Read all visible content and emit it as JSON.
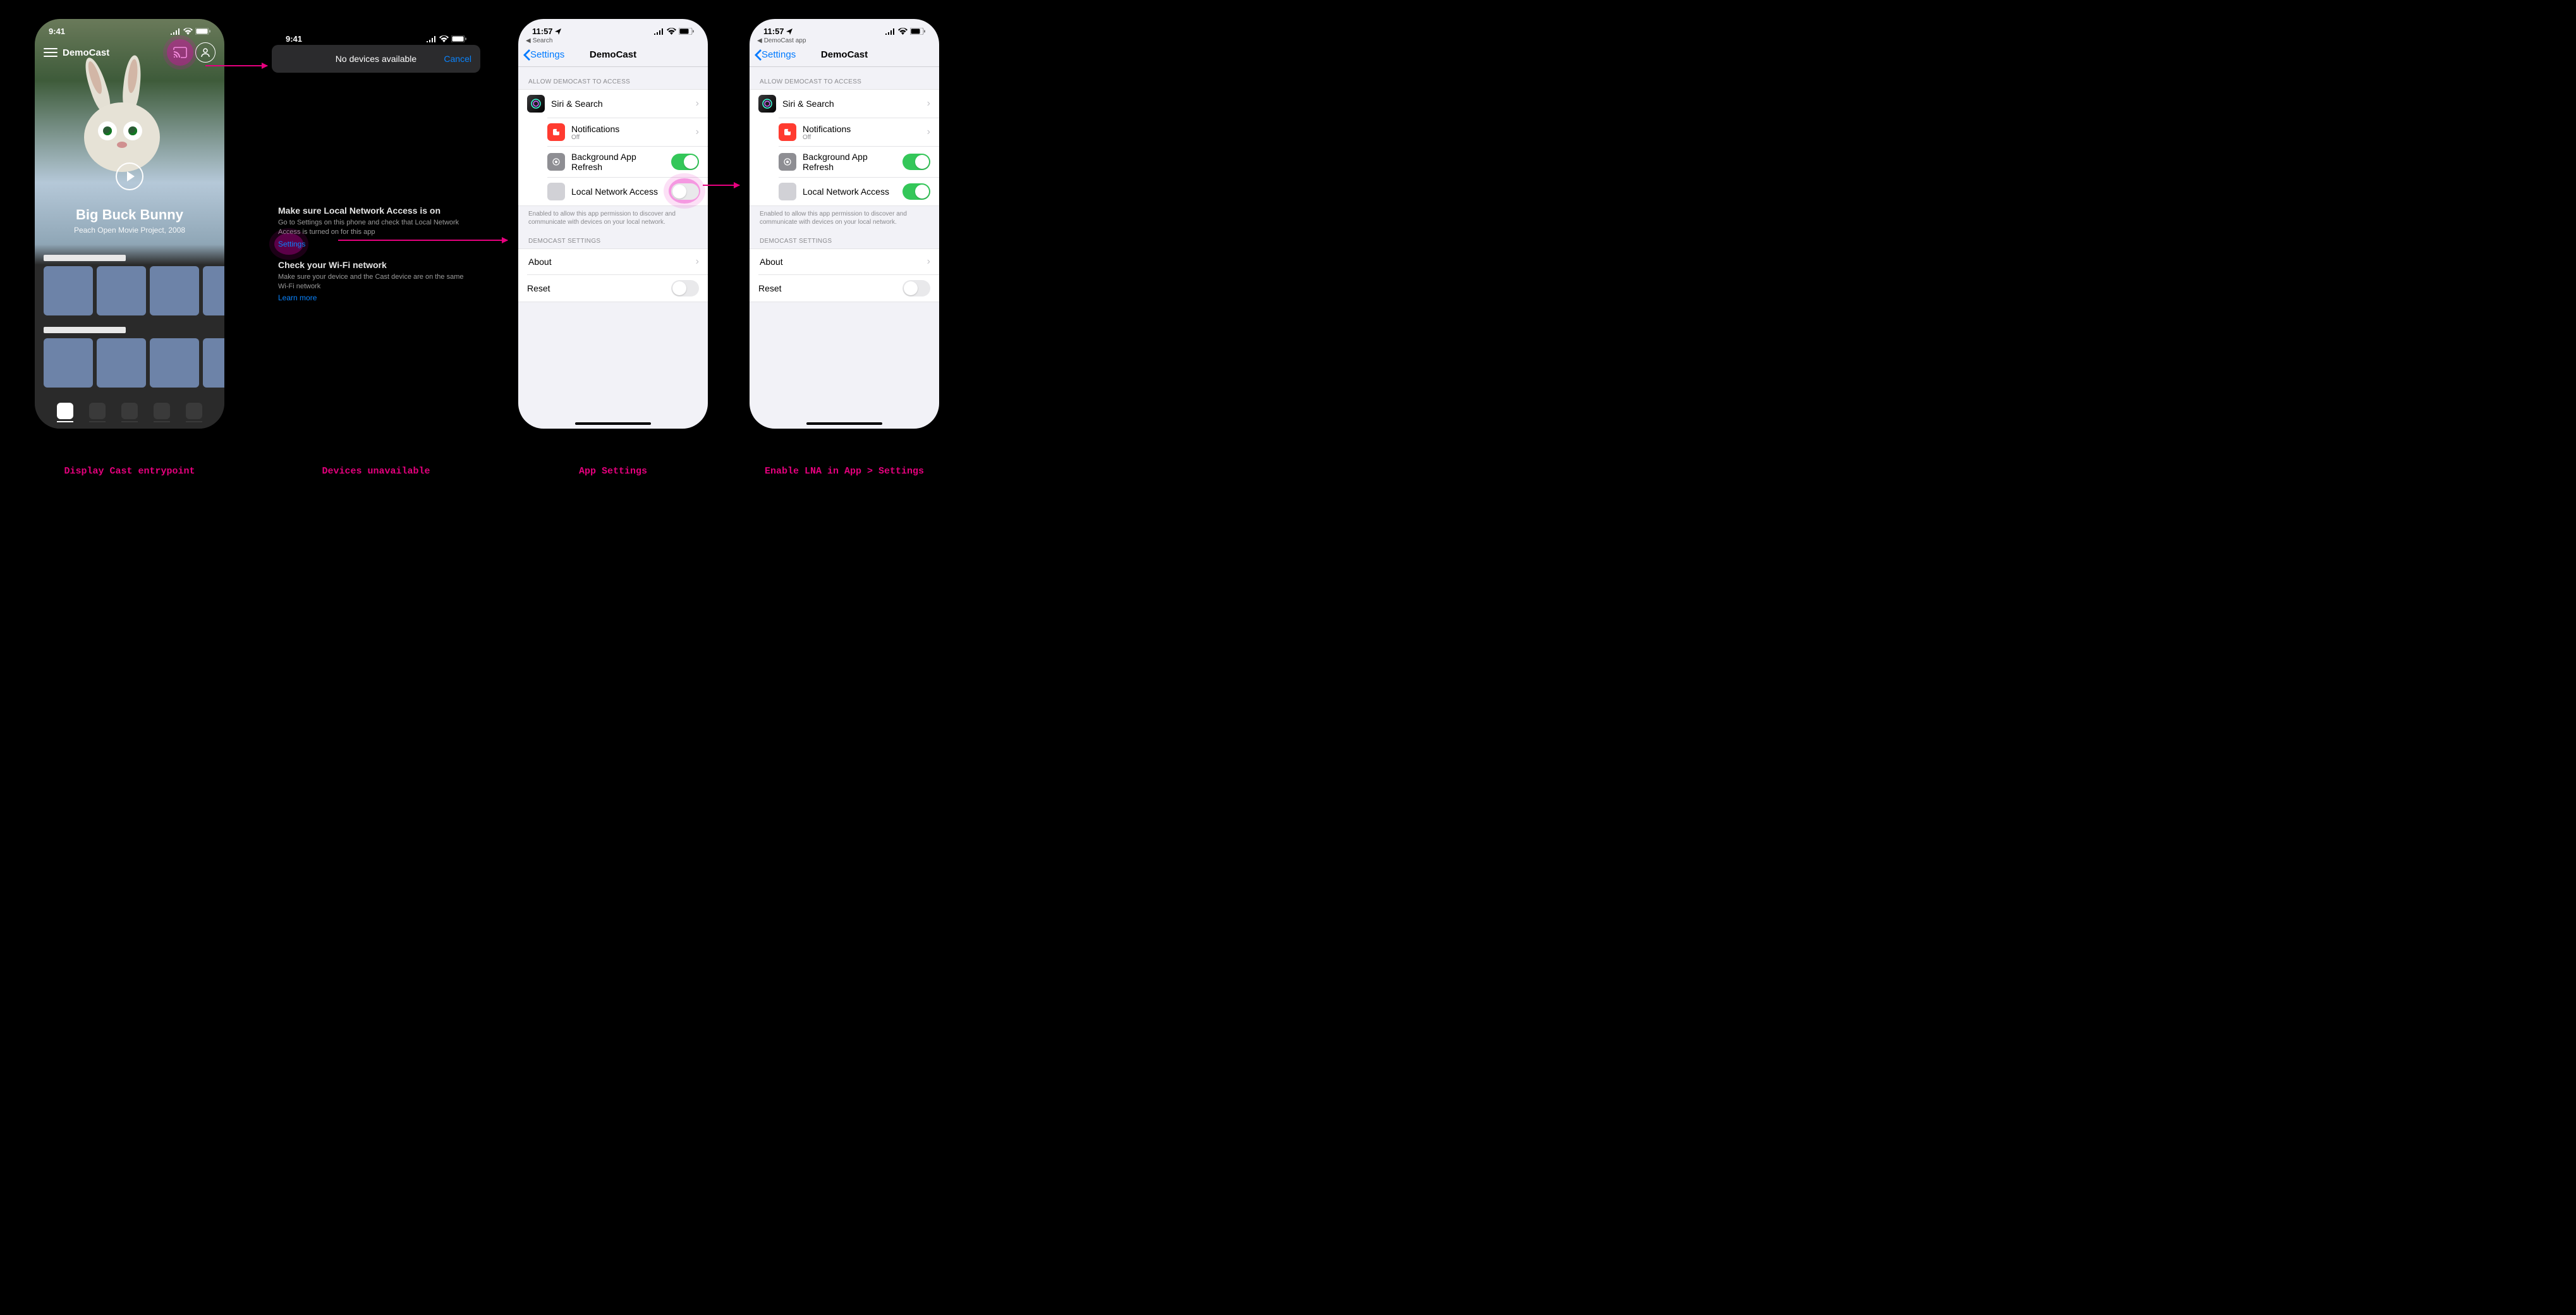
{
  "status": {
    "time_dark": "9:41",
    "time_light": "11:57"
  },
  "colors": {
    "accent": "#e6007e",
    "ios_blue": "#007aff",
    "ios_green": "#34c759"
  },
  "arrows": [
    {
      "from": "cast-button",
      "to": "no-devices-sheet"
    },
    {
      "from": "settings-link",
      "to": "app-settings"
    },
    {
      "from": "lna-toggle-off",
      "to": "lna-toggle-on"
    }
  ],
  "screen1": {
    "app_name": "DemoCast",
    "hero_title": "Big Buck Bunny",
    "hero_subtitle": "Peach Open Movie Project, 2008",
    "highlighted_control": "cast-button"
  },
  "screen2": {
    "sheet_title": "No devices available",
    "cancel": "Cancel",
    "tip1_h": "Make sure Local Network Access is on",
    "tip1_p": "Go to Settings on this phone and check that Local Network Access is turned on for this app",
    "settings_link": "Settings",
    "tip2_h": "Check your Wi-Fi network",
    "tip2_p": "Make sure your device and the Cast device are on the same Wi-Fi network",
    "learn_more": "Learn more",
    "highlighted_control": "settings-link"
  },
  "settings_common": {
    "breadcrumb3": "Search",
    "breadcrumb4": "DemoCast app",
    "back_label": "Settings",
    "title": "DemoCast",
    "section_access": "ALLOW DEMOCAST TO ACCESS",
    "siri": "Siri & Search",
    "notif": "Notifications",
    "notif_sub": "Off",
    "bg_refresh": "Background App Refresh",
    "lna": "Local Network Access",
    "lna_note": "Enabled to allow this app permission to discover and communicate with devices on your local network.",
    "section_app": "DEMOCAST SETTINGS",
    "about": "About",
    "reset": "Reset"
  },
  "screen3": {
    "bg_refresh_on": true,
    "lna_on": false,
    "reset_on": false,
    "highlighted_control": "lna-toggle"
  },
  "screen4": {
    "bg_refresh_on": true,
    "lna_on": true,
    "reset_on": false
  },
  "captions": {
    "c1": "Display Cast entrypoint",
    "c2": "Devices unavailable",
    "c3": "App Settings",
    "c4": "Enable LNA in App > Settings"
  }
}
